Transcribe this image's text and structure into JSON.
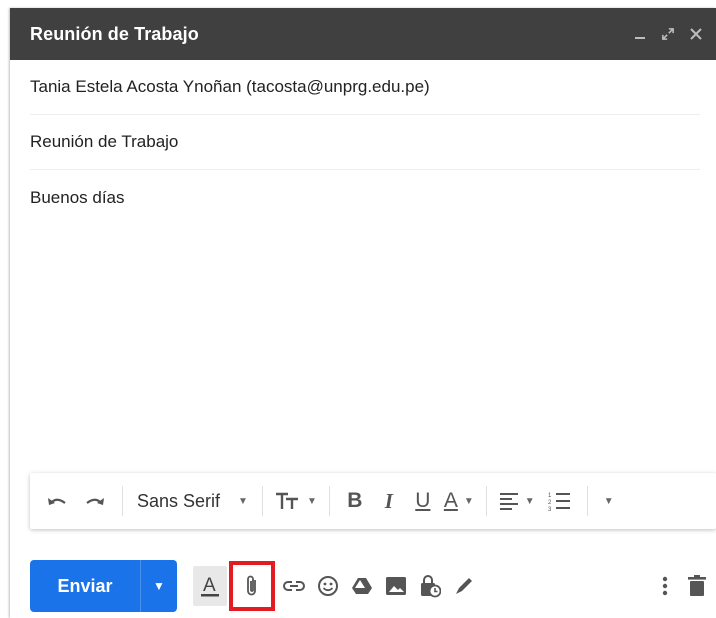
{
  "window": {
    "title": "Reunión de Trabajo",
    "controls": [
      "minimize-icon",
      "expand-icon",
      "close-icon"
    ]
  },
  "compose": {
    "to": "Tania Estela Acosta Ynoñan (tacosta@unprg.edu.pe)",
    "subject": "Reunión de Trabajo",
    "body": "Buenos días"
  },
  "format_bar": {
    "undo_icon": "undo-icon",
    "redo_icon": "redo-icon",
    "font_family": "Sans Serif",
    "text_size_icon": "text-size-icon",
    "bold_label": "B",
    "italic_label": "I",
    "underline_label": "U",
    "text_color_label": "A",
    "align_icon": "align-icon",
    "numbered_list_icon": "numbered-list-icon",
    "more_icon": "more-formatting-icon"
  },
  "bottom_bar": {
    "send_label": "Enviar",
    "icons": [
      "formatting-options-icon",
      "attach-file-icon",
      "insert-link-icon",
      "emoji-icon",
      "drive-icon",
      "insert-photo-icon",
      "confidential-mode-icon",
      "signature-icon"
    ],
    "highlighted_icon": "attach-file-icon",
    "highlight_color": "#e31b23",
    "accent_color": "#1a73e8"
  }
}
